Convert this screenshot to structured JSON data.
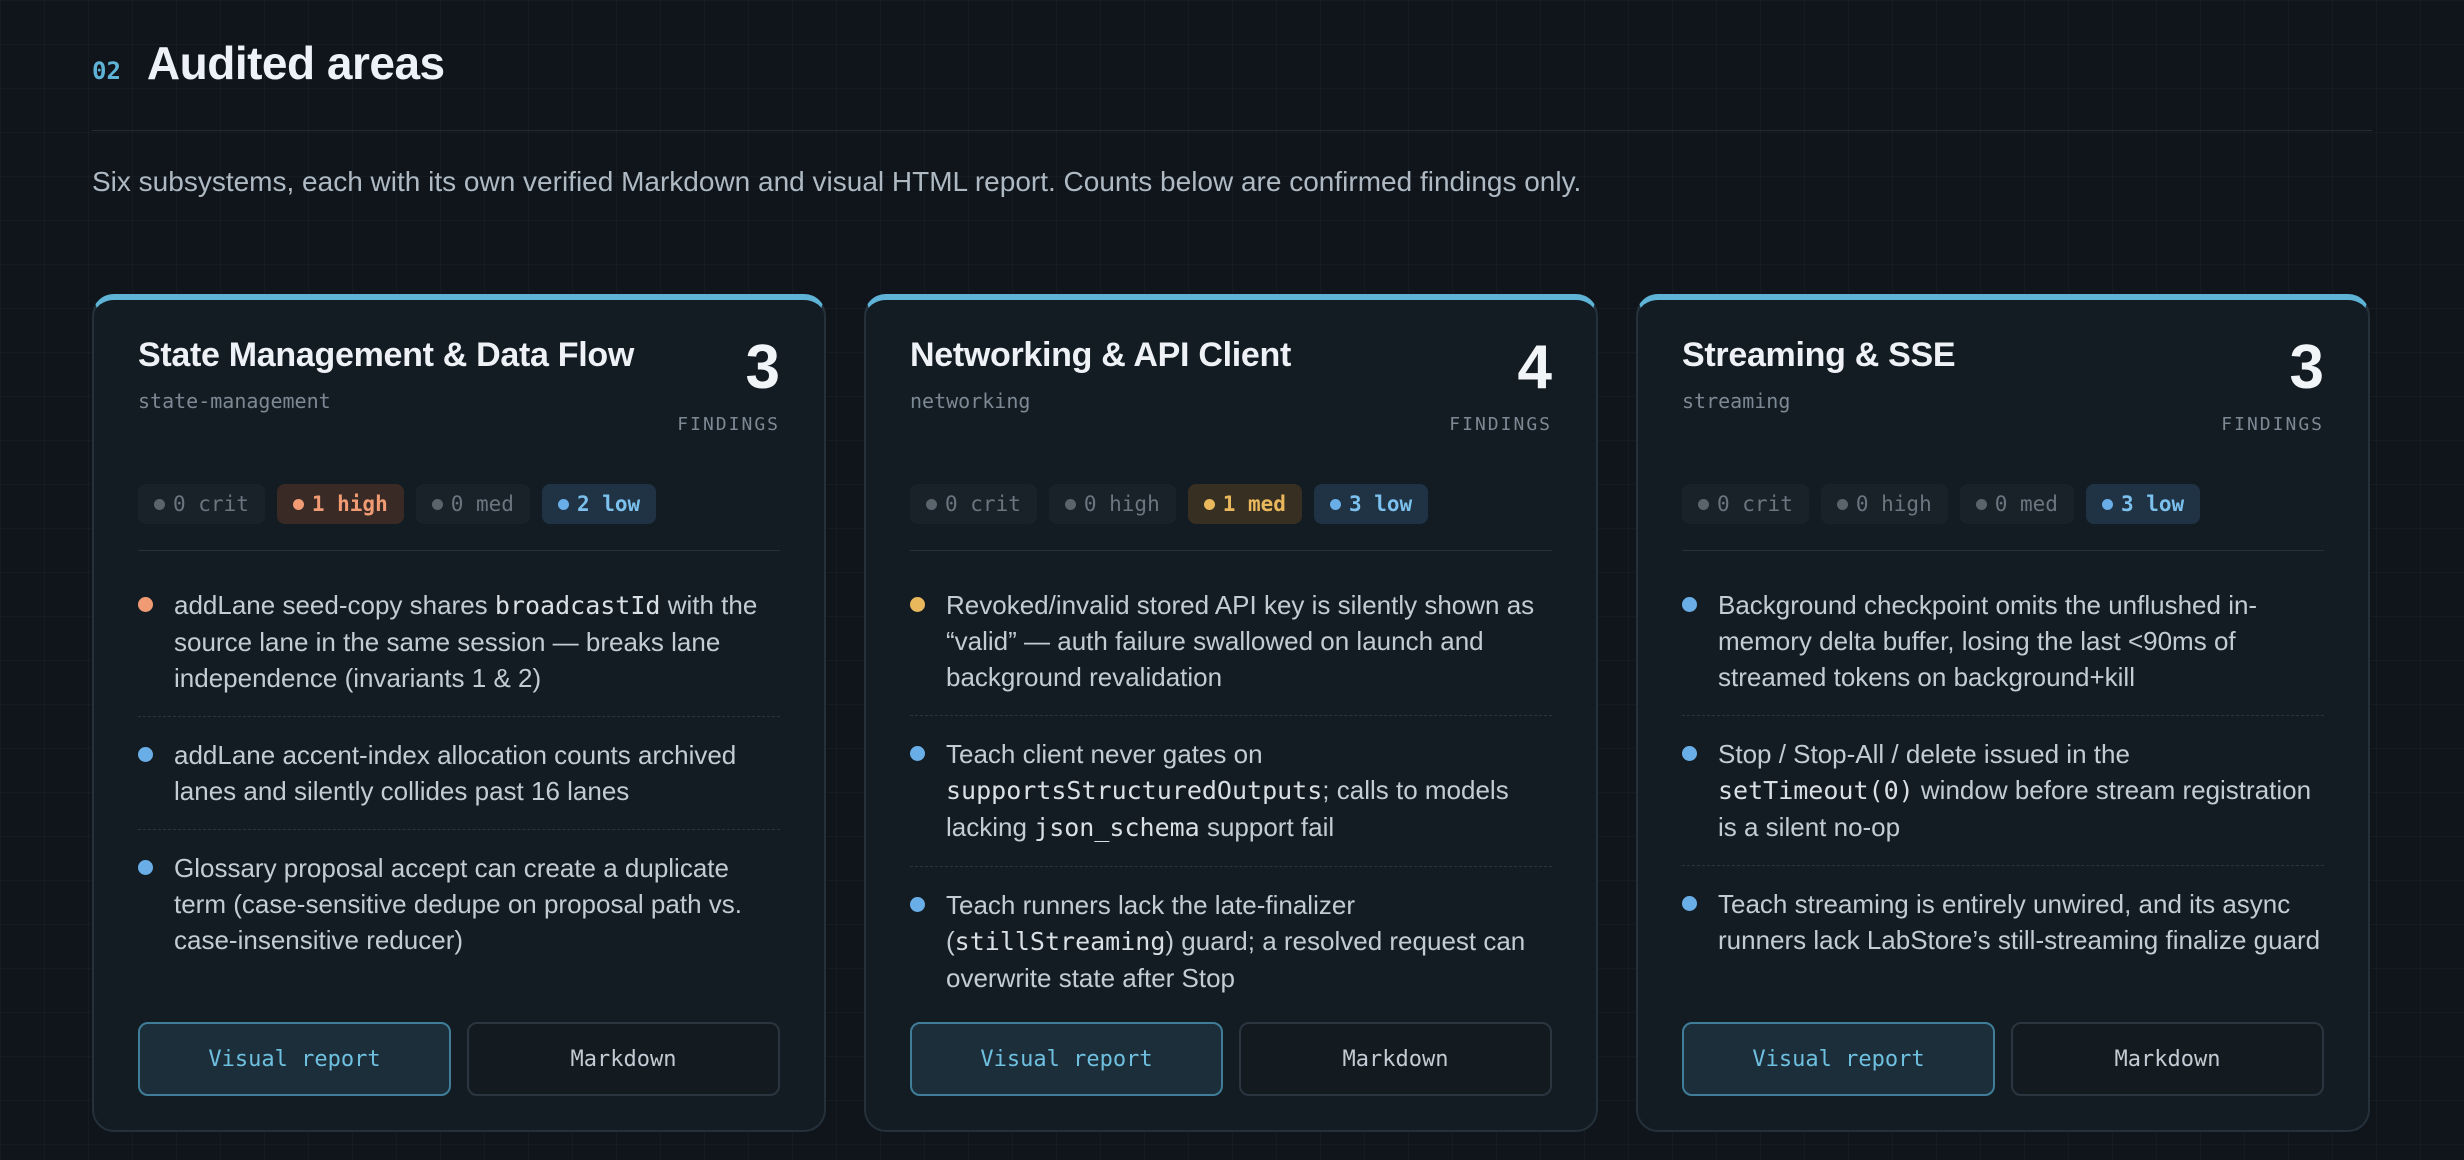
{
  "section": {
    "number": "02",
    "title": "Audited areas",
    "intro": "Six subsystems, each with its own verified Markdown and visual HTML report. Counts below are confirmed findings only."
  },
  "labels": {
    "findings": "FINDINGS",
    "visual_report": "Visual report",
    "markdown": "Markdown"
  },
  "cards": [
    {
      "title": "State Management & Data Flow",
      "slug": "state-management",
      "count": "3",
      "badges": {
        "crit": "0 crit",
        "high": "1 high",
        "med": "0 med",
        "low": "2 low"
      },
      "findings": [
        {
          "severity": "high",
          "parts": [
            "addLane seed-copy shares ",
            "broadcastId",
            " with the source lane in the same session — breaks lane independence (invariants 1 & 2)"
          ]
        },
        {
          "severity": "low",
          "parts": [
            "addLane accent-index allocation counts archived lanes and silently collides past 16 lanes"
          ]
        },
        {
          "severity": "low",
          "parts": [
            "Glossary proposal accept can create a duplicate term (case-sensitive dedupe on proposal path vs. case-insensitive reducer)"
          ]
        }
      ]
    },
    {
      "title": "Networking & API Client",
      "slug": "networking",
      "count": "4",
      "badges": {
        "crit": "0 crit",
        "high": "0 high",
        "med": "1 med",
        "low": "3 low"
      },
      "findings": [
        {
          "severity": "med",
          "parts": [
            "Revoked/invalid stored API key is silently shown as “valid” — auth failure swallowed on launch and background revalidation"
          ]
        },
        {
          "severity": "low",
          "parts": [
            "Teach client never gates on ",
            "supportsStructuredOutputs",
            "; calls to models lacking ",
            "json_schema",
            " support fail"
          ]
        },
        {
          "severity": "low",
          "parts": [
            "Teach runners lack the late-finalizer (",
            "stillStreaming",
            ") guard; a resolved request can overwrite state after Stop"
          ]
        }
      ]
    },
    {
      "title": "Streaming & SSE",
      "slug": "streaming",
      "count": "3",
      "badges": {
        "crit": "0 crit",
        "high": "0 high",
        "med": "0 med",
        "low": "3 low"
      },
      "findings": [
        {
          "severity": "low",
          "parts": [
            "Background checkpoint omits the unflushed in-memory delta buffer, losing the last <90ms of streamed tokens on background+kill"
          ]
        },
        {
          "severity": "low",
          "parts": [
            "Stop / Stop-All / delete issued in the ",
            "setTimeout(0)",
            " window before stream registration is a silent no-op"
          ]
        },
        {
          "severity": "low",
          "parts": [
            "Teach streaming is entirely unwired, and its async runners lack LabStore’s still-streaming finalize guard"
          ]
        }
      ]
    }
  ],
  "colors": {
    "accent": "#5fb3d6",
    "high": "#f09b73",
    "med": "#e9b85c",
    "low": "#6aaee8"
  }
}
